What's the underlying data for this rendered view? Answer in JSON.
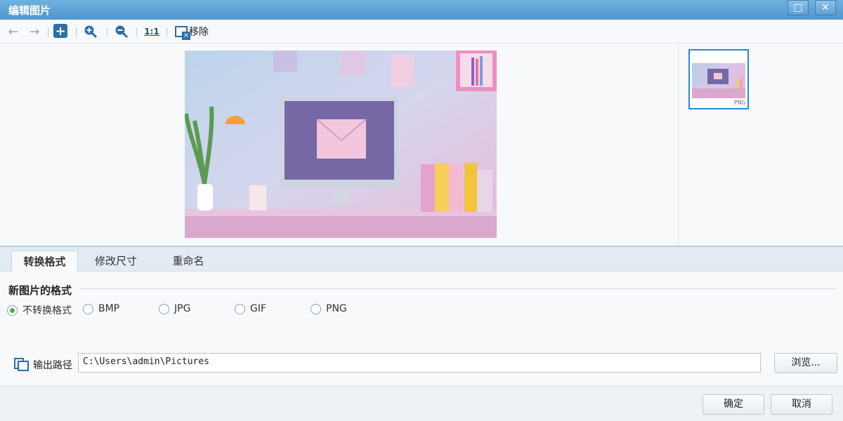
{
  "window": {
    "title": "编辑图片"
  },
  "toolbar": {
    "back_icon": "arrow-left-icon",
    "forward_icon": "arrow-right-icon",
    "add_icon": "plus-icon",
    "zoom_in_icon": "zoom-in-icon",
    "zoom_out_icon": "zoom-out-icon",
    "actual_size_label": "1:1",
    "remove_label": "移除"
  },
  "preview": {
    "thumbnail_format": "PNG"
  },
  "tabs": [
    {
      "label": "转换格式",
      "active": true
    },
    {
      "label": "修改尺寸",
      "active": false
    },
    {
      "label": "重命名",
      "active": false
    }
  ],
  "format_section": {
    "title": "新图片的格式",
    "options": [
      {
        "label": "不转换格式",
        "checked": true
      },
      {
        "label": "BMP",
        "checked": false
      },
      {
        "label": "JPG",
        "checked": false
      },
      {
        "label": "GIF",
        "checked": false
      },
      {
        "label": "PNG",
        "checked": false
      }
    ]
  },
  "output": {
    "label": "输出路径",
    "path": "C:\\Users\\admin\\Pictures",
    "browse_label": "浏览..."
  },
  "footer": {
    "ok_label": "确定",
    "cancel_label": "取消"
  },
  "colors": {
    "titlebar": "#5aa3d9",
    "accent": "#2b6fa8",
    "radio_checked": "#3fb34f"
  }
}
